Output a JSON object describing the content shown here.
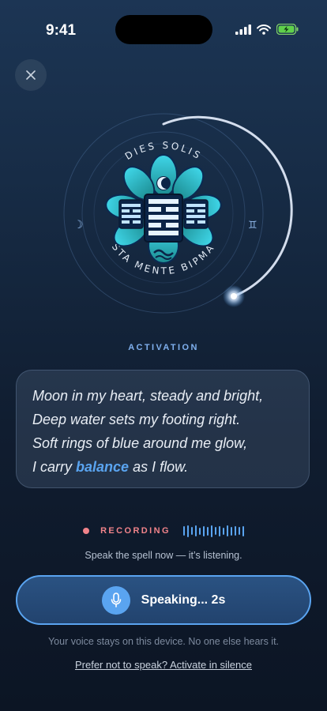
{
  "status_bar": {
    "time": "9:41"
  },
  "emblem": {
    "top_text": "DIES SOLIS",
    "bottom_text": "STA MENTE BIPMA"
  },
  "activation_label": "ACTIVATION",
  "verse": {
    "line1": "Moon in my heart, steady and bright,",
    "line2": "Deep water sets my footing right.",
    "line3": "Soft rings of blue around me glow,",
    "line4_before": "I carry ",
    "line4_highlight": "balance",
    "line4_after": " as I flow."
  },
  "recording": {
    "label": "RECORDING",
    "hint": "Speak the spell now — it’s listening."
  },
  "speak_button": {
    "label": "Speaking... 2s"
  },
  "privacy_note": "Your voice stays on this device. No one else hears it.",
  "silent_link": "Prefer not to speak? Activate in silence",
  "colors": {
    "accent": "#5aa4f0",
    "recording": "#f0838a",
    "background": "#172c46"
  }
}
